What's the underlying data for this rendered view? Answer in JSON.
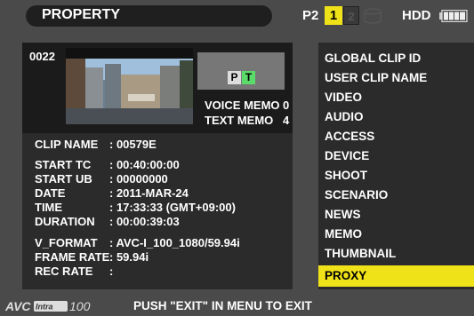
{
  "header": {
    "title": "PROPERTY",
    "media": {
      "p2_label": "P2",
      "slot1": "1",
      "slot2": "2",
      "hdd_label": "HDD",
      "icons": [
        "hdd-drive-icon",
        "battery-icon"
      ]
    }
  },
  "clip": {
    "number": "0022",
    "pt_badge": {
      "p": "P",
      "t": "T",
      "p_color": "#dddddd",
      "t_color": "#5bdb6a"
    },
    "voice_memo_label": "VOICE MEMO",
    "voice_memo_value": "0",
    "text_memo_label": "TEXT MEMO",
    "text_memo_value": "4"
  },
  "info": [
    {
      "label": "CLIP NAME",
      "value": ": 00579E"
    },
    {
      "label": "START TC",
      "value": ": 00:40:00:00"
    },
    {
      "label": "START UB",
      "value": ": 00000000"
    },
    {
      "label": "DATE",
      "value": ": 2011-MAR-24"
    },
    {
      "label": "TIME",
      "value": ": 17:33:33 (GMT+09:00)"
    },
    {
      "label": "DURATION",
      "value": ": 00:00:39:03"
    },
    {
      "label": "V_FORMAT",
      "value": ": AVC-I_100_1080/59.94i"
    },
    {
      "label": "FRAME RATE",
      "value": ": 59.94i"
    },
    {
      "label": "REC RATE",
      "value": ":"
    }
  ],
  "menu": {
    "items": [
      "GLOBAL CLIP ID",
      "USER CLIP NAME",
      "VIDEO",
      "AUDIO",
      "ACCESS",
      "DEVICE",
      "SHOOT",
      "SCENARIO",
      "NEWS",
      "MEMO",
      "THUMBNAIL",
      "PROXY"
    ],
    "selected": "PROXY"
  },
  "footer": {
    "logo_text": "AVC-Intra100",
    "message": "PUSH \"EXIT\" IN MENU TO EXIT"
  },
  "colors": {
    "accent_yellow": "#f0e218",
    "background": "#4a4a4a",
    "panel": "#2b2b2b"
  }
}
